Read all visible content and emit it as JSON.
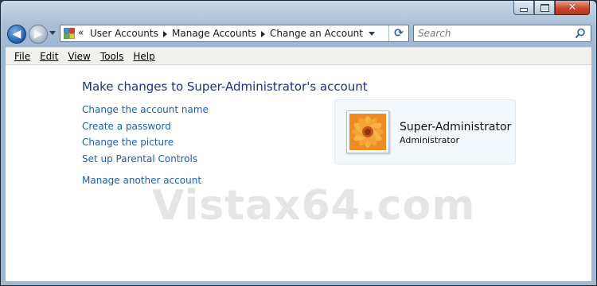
{
  "address_bar": {
    "chevron": "«",
    "breadcrumbs": [
      "User Accounts",
      "Manage Accounts",
      "Change an Account"
    ]
  },
  "search": {
    "placeholder": "Search"
  },
  "menu": [
    "File",
    "Edit",
    "View",
    "Tools",
    "Help"
  ],
  "content": {
    "heading": "Make changes to Super-Administrator's account",
    "links": [
      "Change the account name",
      "Create a password",
      "Change the picture",
      "Set up Parental Controls"
    ],
    "manage_link": "Manage another account"
  },
  "account": {
    "name": "Super-Administrator",
    "type": "Administrator",
    "picture_icon": "orange-flower"
  },
  "watermark": "Vistax64.com",
  "colors": {
    "link": "#1e5fb0",
    "heading": "#1e3287",
    "close_button": "#c9462b"
  }
}
